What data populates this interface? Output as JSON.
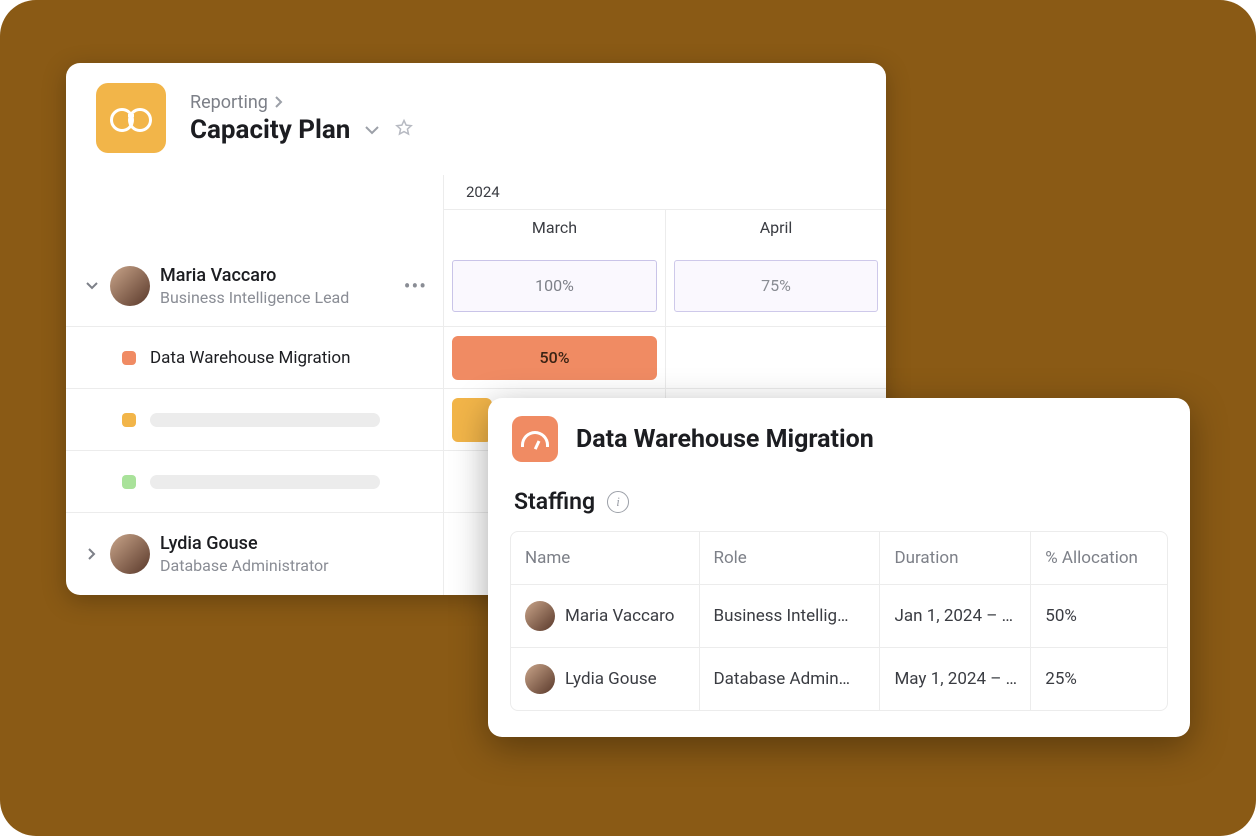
{
  "breadcrumb": {
    "parent": "Reporting"
  },
  "page": {
    "title": "Capacity Plan"
  },
  "timeline": {
    "year": "2024",
    "months": [
      "March",
      "April"
    ]
  },
  "people": [
    {
      "name": "Maria Vaccaro",
      "role": "Business Intelligence Lead",
      "expanded": true,
      "allocations": [
        "100%",
        "75%"
      ],
      "tasks": [
        {
          "label": "Data Warehouse Migration",
          "color": "orange",
          "bar_value": "50%"
        },
        {
          "label": "",
          "color": "amber",
          "bar_value": ""
        },
        {
          "label": "",
          "color": "green",
          "bar_value": ""
        }
      ]
    },
    {
      "name": "Lydia Gouse",
      "role": "Database Administrator",
      "expanded": false
    }
  ],
  "detail": {
    "title": "Data Warehouse Migration",
    "section": "Staffing",
    "columns": [
      "Name",
      "Role",
      "Duration",
      "% Allocation"
    ],
    "rows": [
      {
        "name": "Maria Vaccaro",
        "role": "Business Intellig…",
        "duration": "Jan 1, 2024 – …",
        "allocation": "50%"
      },
      {
        "name": "Lydia Gouse",
        "role": "Database Admin…",
        "duration": "May 1, 2024 – …",
        "allocation": "25%"
      }
    ]
  },
  "colors": {
    "brand_amber": "#f2b549",
    "bar_orange": "#f08b63",
    "bar_green": "#a9e29a",
    "canvas_bg": "#8a5a15"
  }
}
